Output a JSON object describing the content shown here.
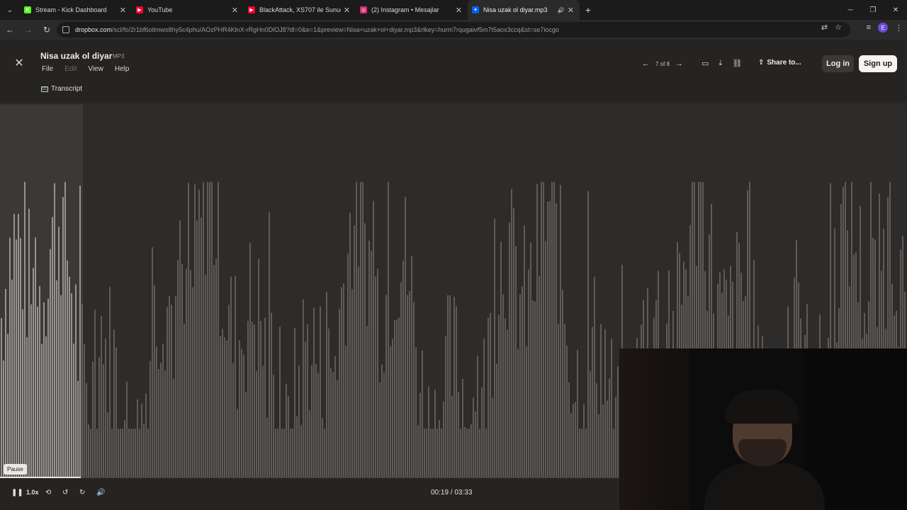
{
  "browser": {
    "tabs": [
      {
        "title": "Stream - Kick Dashboard",
        "favicon": "kick-icon",
        "color": "#53fc18",
        "glyph": "K",
        "active": false
      },
      {
        "title": "YouTube",
        "favicon": "youtube-icon",
        "color": "#ff0033",
        "glyph": "▶",
        "active": false
      },
      {
        "title": "BlackAttack, XS707 ile Sunucu",
        "favicon": "youtube-icon",
        "color": "#ff0033",
        "glyph": "▶",
        "active": false
      },
      {
        "title": "(2) Instagram • Mesajlar",
        "favicon": "instagram-icon",
        "color": "#d62976",
        "glyph": "◎",
        "active": false
      },
      {
        "title": "Nisa uzak ol diyar.mp3",
        "favicon": "dropbox-icon",
        "color": "#0061fe",
        "glyph": "✦",
        "active": true
      }
    ],
    "url_host": "dropbox.com",
    "url_path": "/scl/fo/2r1bf6oitmws8hy5c4phu/AOzPHR4KlnX-rRgHn0DlOJ8?dl=0&e=1&preview=Nisa+uzak+ol+diyar.mp3&rlkey=hurm7rqugaivf5m7t5aox3ccq&st=se7iocgo",
    "profile_initial": "E"
  },
  "viewer": {
    "file_name": "Nisa uzak ol diyar",
    "file_ext": "MP3",
    "menu": [
      "File",
      "Edit",
      "View",
      "Help"
    ],
    "transcript_label": "Transcript",
    "pager_text": "7 of 8",
    "share_label": "Share to...",
    "login_label": "Log in",
    "signup_label": "Sign up"
  },
  "player": {
    "tooltip": "Pause",
    "speed": "1.0x",
    "time": "00:19 / 03:33",
    "progress": 0.089
  },
  "colors": {
    "accent": "#e8e6e3",
    "played_wave": "#f2f0ed",
    "unplayed_wave": "#8d8a86"
  }
}
